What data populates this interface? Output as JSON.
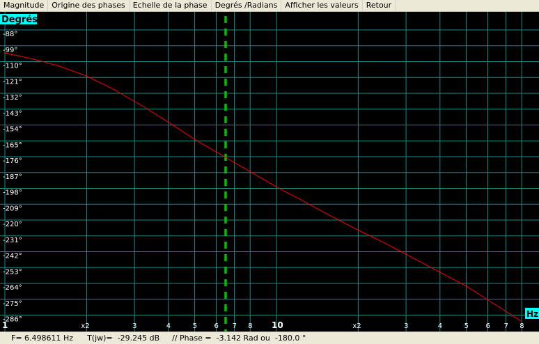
{
  "menu": {
    "items": [
      {
        "label": "Magnitude"
      },
      {
        "label": "Origine des phases"
      },
      {
        "label": "Echelle de la phase"
      },
      {
        "label": "Degrés /Radians"
      },
      {
        "label": "Afficher les valeurs"
      },
      {
        "label": "Retour"
      }
    ]
  },
  "colors": {
    "grid": "#1e8a8a",
    "curve": "#ff0000",
    "cursor": "#00c000",
    "unit_box": "#00ffff",
    "background": "#000000"
  },
  "chart_data": {
    "type": "line",
    "ylabel": "Degrés",
    "xlabel": "Hz",
    "x_scale": "log",
    "xlim": [
      1,
      9
    ],
    "ylim": [
      -286,
      -88
    ],
    "y_ticks": [
      "-88°",
      "-99°",
      "-110°",
      "-121°",
      "-132°",
      "-143°",
      "-154°",
      "-165°",
      "-176°",
      "-187°",
      "-198°",
      "-209°",
      "-220°",
      "-231°",
      "-242°",
      "-253°",
      "-264°",
      "-275°",
      "-286°"
    ],
    "x_ticks": [
      {
        "value": 1,
        "label": "1"
      },
      {
        "value": 2,
        "label": "x2"
      },
      {
        "value": 3,
        "label": "3"
      },
      {
        "value": 4,
        "label": "4"
      },
      {
        "value": 5,
        "label": "5"
      },
      {
        "value": 6,
        "label": "6"
      },
      {
        "value": 7,
        "label": "7"
      },
      {
        "value": 8,
        "label": "8"
      },
      {
        "value": 10,
        "label": "10"
      },
      {
        "value": 20,
        "label": "x2"
      },
      {
        "value": 30,
        "label": "3"
      },
      {
        "value": 40,
        "label": "4"
      },
      {
        "value": 50,
        "label": "5"
      },
      {
        "value": 60,
        "label": "6"
      },
      {
        "value": 70,
        "label": "7"
      },
      {
        "value": 80,
        "label": "8"
      }
    ],
    "cursor_x": 6.498611,
    "series": [
      {
        "points": [
          [
            1.0,
            -104
          ],
          [
            1.26,
            -108
          ],
          [
            1.58,
            -113
          ],
          [
            2.0,
            -120
          ],
          [
            2.5,
            -129
          ],
          [
            3.16,
            -140
          ],
          [
            4.0,
            -152
          ],
          [
            5.0,
            -164
          ],
          [
            6.3,
            -175
          ],
          [
            7.94,
            -186
          ],
          [
            10.0,
            -197
          ],
          [
            12.6,
            -207
          ],
          [
            15.8,
            -217
          ],
          [
            20.0,
            -227
          ],
          [
            25.1,
            -236
          ],
          [
            31.6,
            -246
          ],
          [
            39.8,
            -256
          ],
          [
            50.1,
            -266
          ],
          [
            63.1,
            -278
          ],
          [
            79.4,
            -290
          ]
        ]
      }
    ]
  },
  "status": {
    "freq": "F= 6.498611 Hz",
    "tjw": "T(jw)=  -29.245 dB",
    "phase": "// Phase =  -3.142 Rad ou  -180.0 °"
  }
}
